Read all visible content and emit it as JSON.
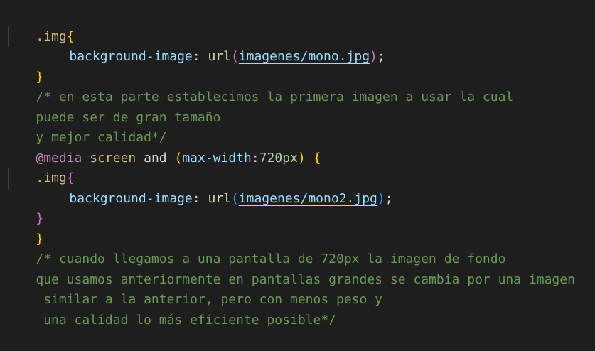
{
  "code": {
    "l1_selector": ".img",
    "l1_brace": "{",
    "l2_property": "background-image",
    "l2_colon": ": ",
    "l2_func": "url",
    "l2_paren_open": "(",
    "l2_path": "imagenes/mono.jpg",
    "l2_paren_close": ")",
    "l2_semi": ";",
    "l3_brace": "}",
    "comment1_line1": "/* en esta parte establecimos la primera imagen a usar la cual",
    "comment1_line2": "puede ser de gran tamaño",
    "comment1_line3": "y mejor calidad*/",
    "media_at": "@media",
    "media_screen": "screen",
    "media_and": "and",
    "media_paren_open": "(",
    "media_feature": "max-width",
    "media_colon": ":",
    "media_value": "720px",
    "media_paren_close": ")",
    "media_brace": "{",
    "l8_selector": ".img",
    "l8_brace": "{",
    "l9_property": "background-image",
    "l9_colon": ": ",
    "l9_func": "url",
    "l9_paren_open": "(",
    "l9_path": "imagenes/mono2.jpg",
    "l9_paren_close": ")",
    "l9_semi": ";",
    "l10_brace": "}",
    "l11_brace": "}",
    "comment2_line1": "/* cuando llegamos a una pantalla de 720px la imagen de fondo",
    "comment2_line2": "que usamos anteriormente en pantallas grandes se cambia por una imagen",
    "comment2_line3": " similar a la anterior, pero con menos peso y",
    "comment2_line4": " una calidad lo más eficiente posible*/"
  },
  "colors": {
    "background": "#1e1e1e",
    "selector": "#d7ba7d",
    "property": "#9cdcfe",
    "function": "#dcdcaa",
    "comment": "#6a9955",
    "at_rule": "#c586c0",
    "number": "#b5cea8",
    "brace_level1": "#ffd700",
    "brace_level2": "#da70d6",
    "brace_level3": "#179fff"
  }
}
